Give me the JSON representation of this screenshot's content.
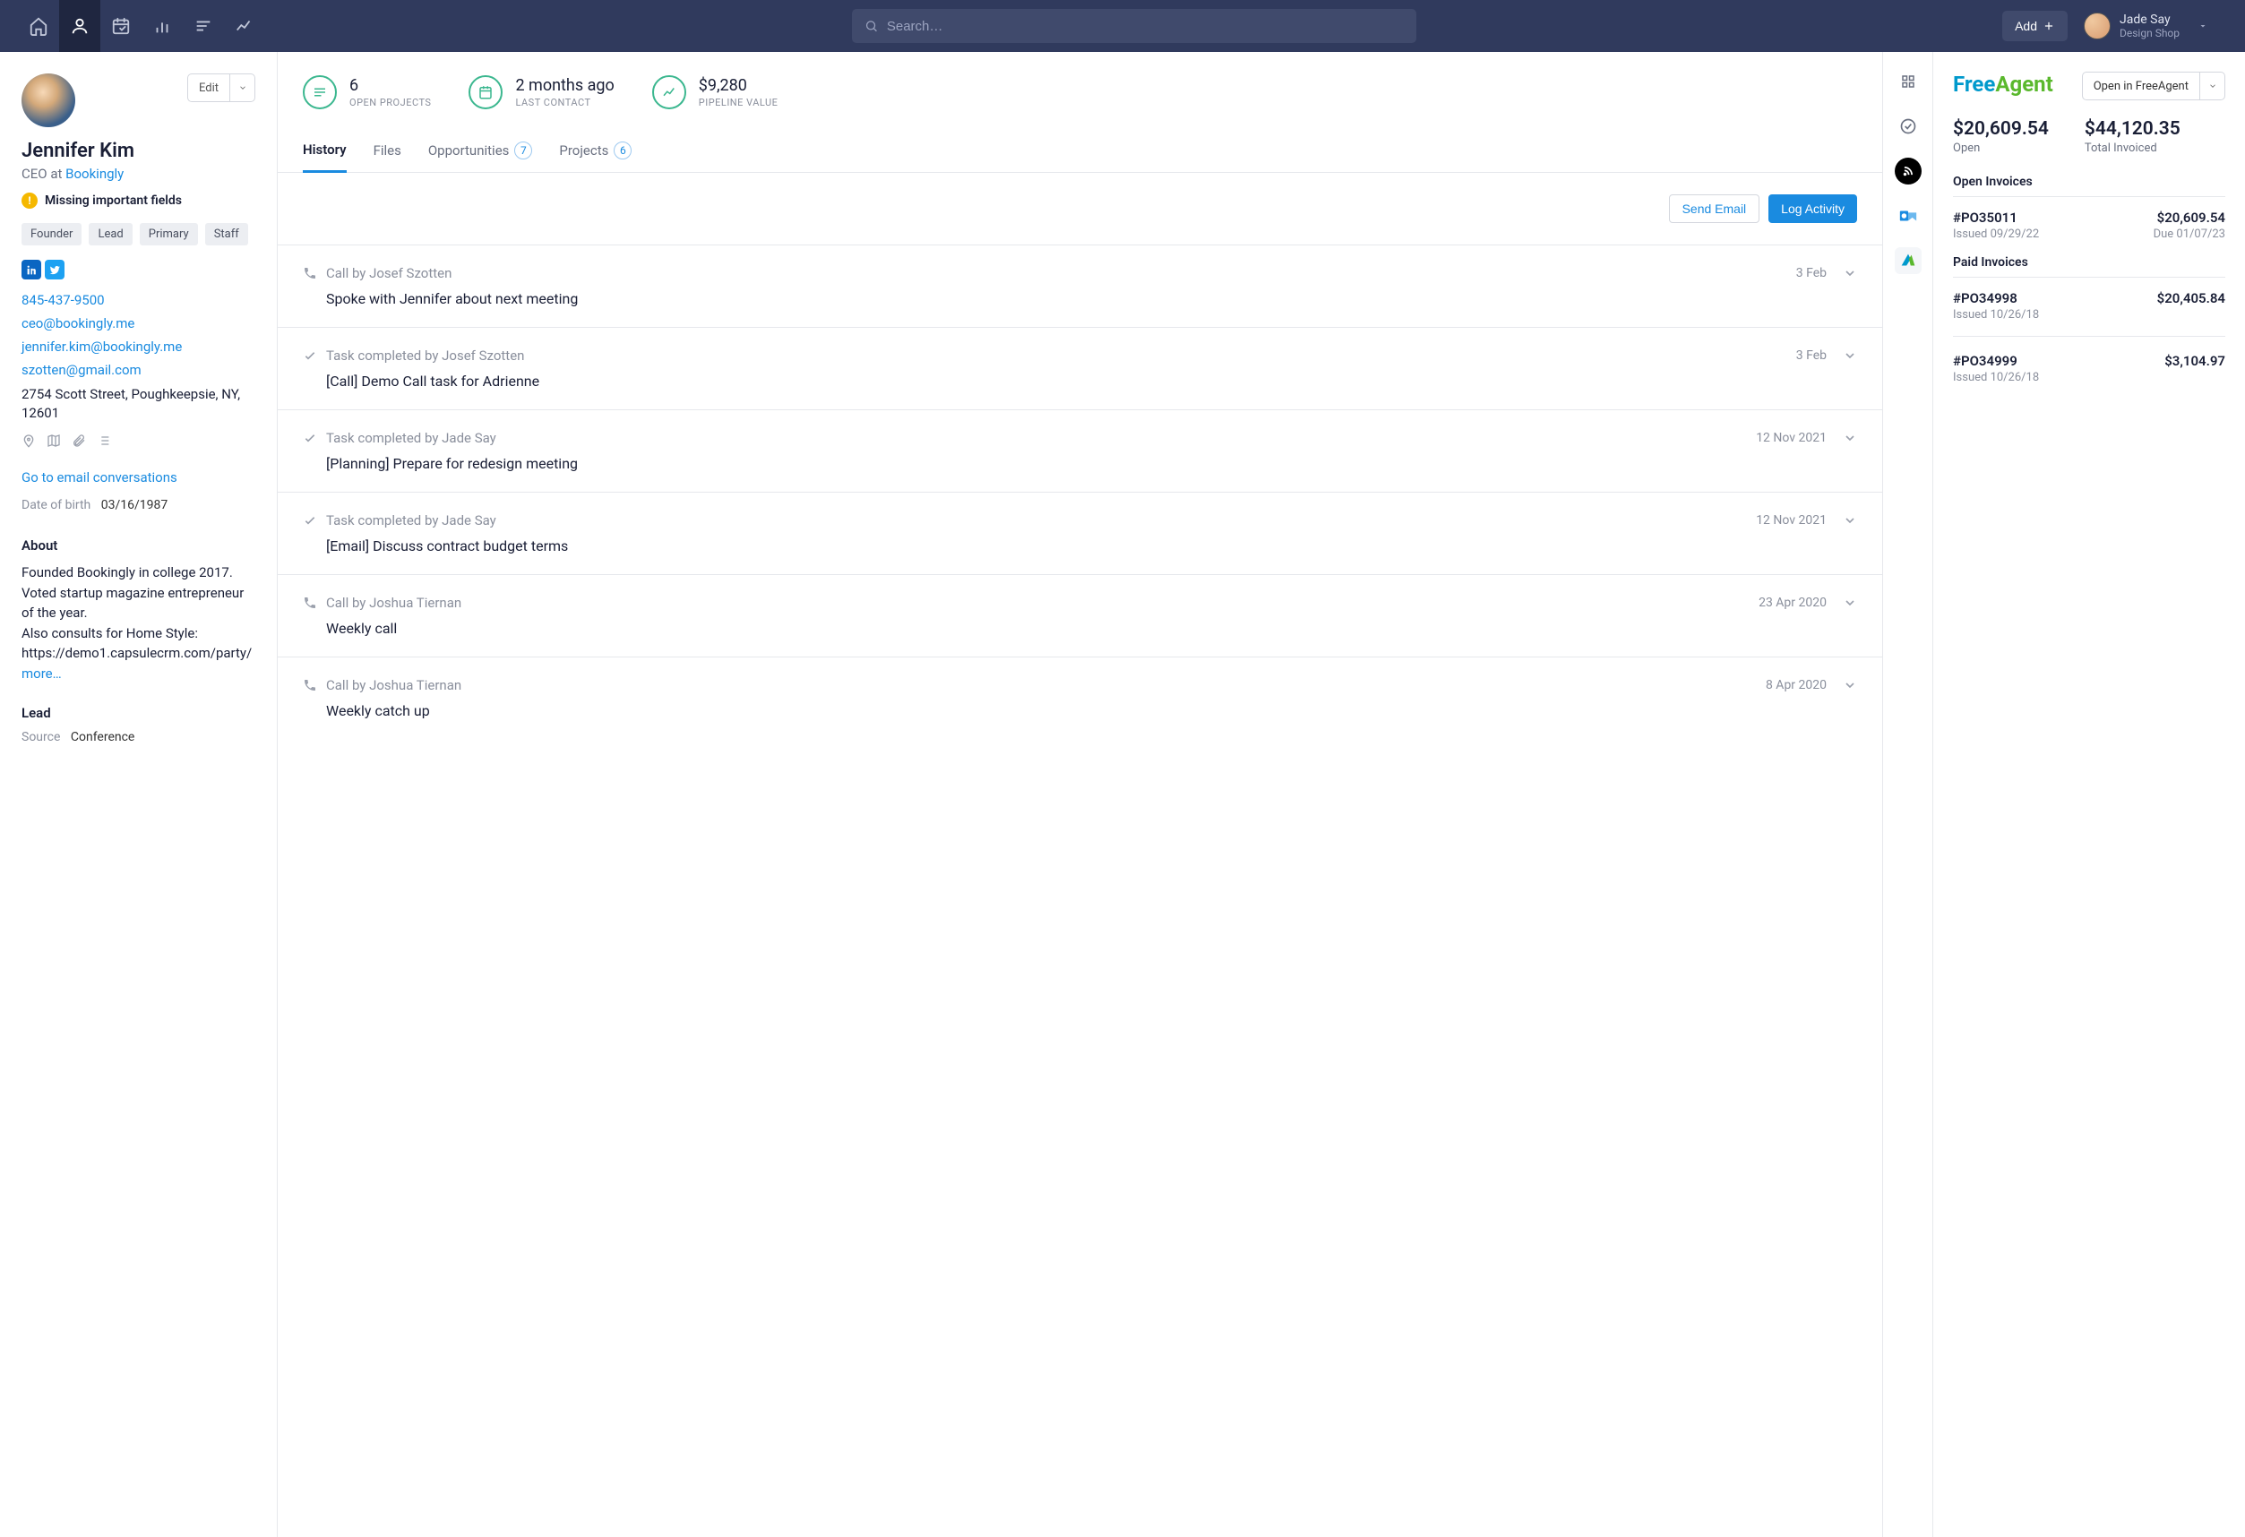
{
  "topnav": {
    "search_placeholder": "Search…",
    "add_label": "Add",
    "user_name": "Jade Say",
    "user_shop": "Design Shop"
  },
  "contact": {
    "name": "Jennifer Kim",
    "role": "CEO at ",
    "company": "Bookingly",
    "edit_label": "Edit",
    "warning": "Missing important fields",
    "tags": [
      "Founder",
      "Lead",
      "Primary",
      "Staff"
    ],
    "phone": "845-437-9500",
    "emails": [
      "ceo@bookingly.me",
      "jennifer.kim@bookingly.me",
      "szotten@gmail.com"
    ],
    "address": "2754 Scott Street, Poughkeepsie, NY, 12601",
    "email_conv_link": "Go to email conversations",
    "dob_label": "Date of birth",
    "dob": "03/16/1987",
    "about_header": "About",
    "about_text": "Founded Bookingly in college 2017. Voted startup magazine entrepreneur of the year.\nAlso consults for Home Style: https://demo1.capsulecrm.com/party/",
    "more": "more…",
    "lead_header": "Lead",
    "source_label": "Source",
    "source": "Conference"
  },
  "stats": [
    {
      "value": "6",
      "label": "OPEN PROJECTS"
    },
    {
      "value": "2 months ago",
      "label": "LAST CONTACT"
    },
    {
      "value": "$9,280",
      "label": "PIPELINE VALUE"
    }
  ],
  "tabs": [
    {
      "label": "History",
      "active": true
    },
    {
      "label": "Files"
    },
    {
      "label": "Opportunities",
      "count": "7"
    },
    {
      "label": "Projects",
      "count": "6"
    }
  ],
  "actions": {
    "send_email": "Send Email",
    "log_activity": "Log Activity"
  },
  "feed": [
    {
      "type": "call",
      "by": "Call by Josef Szotten",
      "date": "3 Feb",
      "title": "Spoke with Jennifer about next meeting"
    },
    {
      "type": "task",
      "by": "Task completed by Josef Szotten",
      "date": "3 Feb",
      "title": "[Call] Demo Call task for Adrienne"
    },
    {
      "type": "task",
      "by": "Task completed by Jade Say",
      "date": "12 Nov 2021",
      "title": "[Planning] Prepare for redesign meeting"
    },
    {
      "type": "task",
      "by": "Task completed by Jade Say",
      "date": "12 Nov 2021",
      "title": "[Email] Discuss contract budget terms"
    },
    {
      "type": "call",
      "by": "Call by Joshua Tiernan",
      "date": "23 Apr 2020",
      "title": "Weekly call"
    },
    {
      "type": "call",
      "by": "Call by Joshua Tiernan",
      "date": "8 Apr 2020",
      "title": "Weekly catch up"
    }
  ],
  "freeagent": {
    "open_label": "Open in FreeAgent",
    "open_amount": "$20,609.54",
    "open_label2": "Open",
    "total_amount": "$44,120.35",
    "total_label": "Total Invoiced",
    "open_invoices_hdr": "Open Invoices",
    "paid_invoices_hdr": "Paid Invoices",
    "open_invoices": [
      {
        "id": "#PO35011",
        "issued": "Issued 09/29/22",
        "amount": "$20,609.54",
        "due": "Due 01/07/23"
      }
    ],
    "paid_invoices": [
      {
        "id": "#PO34998",
        "issued": "Issued 10/26/18",
        "amount": "$20,405.84"
      },
      {
        "id": "#PO34999",
        "issued": "Issued 10/26/18",
        "amount": "$3,104.97"
      }
    ]
  }
}
